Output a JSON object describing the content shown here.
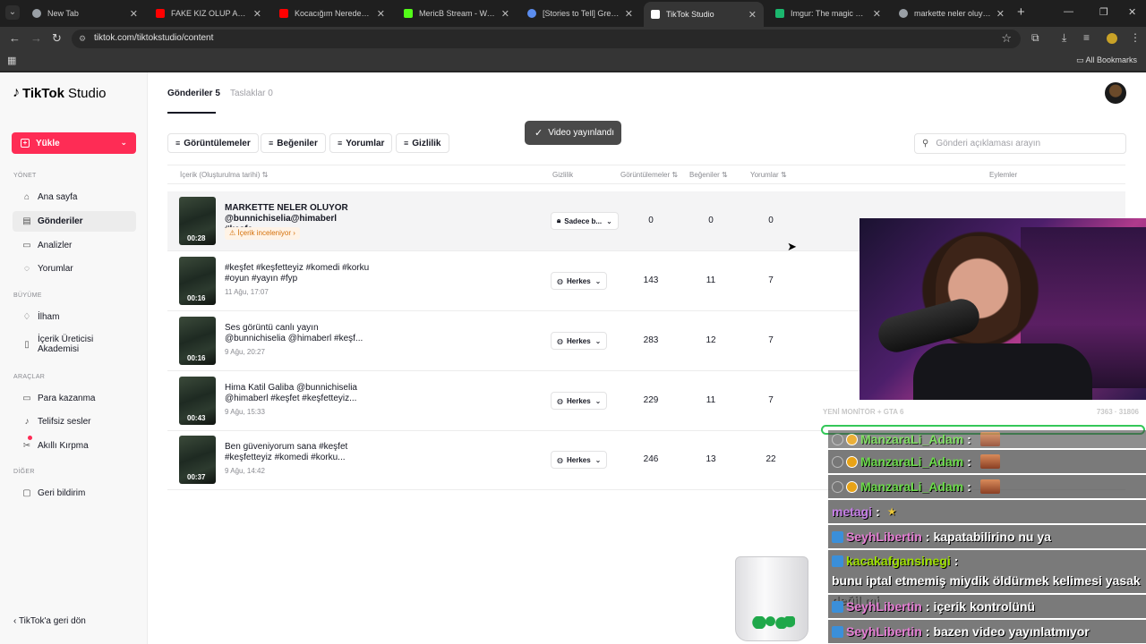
{
  "browser": {
    "tabs": [
      {
        "title": "New Tab",
        "fav": "#9aa0a6"
      },
      {
        "title": "FAKE KIZ OLUP AZGIN ÇO",
        "fav": "#ff0000"
      },
      {
        "title": "Kocacığım Neredesin Kon",
        "fav": "#ff0000"
      },
      {
        "title": "MericB Stream - Watch Li",
        "fav": "#53fc18"
      },
      {
        "title": "[Stories to Tell] Greyville S",
        "fav": "#5b8def"
      },
      {
        "title": "TikTok Studio",
        "fav": "#ffffff"
      },
      {
        "title": "Imgur: The magic of the I",
        "fav": "#1bb76e"
      },
      {
        "title": "markette neler oluyor.mp",
        "fav": "#9aa0a6"
      }
    ],
    "url": "tiktok.com/tiktokstudio/content",
    "bookmarks_label": "All Bookmarks"
  },
  "sidebar": {
    "logo_text": "TikTok",
    "logo_studio": "Studio",
    "upload_label": "Yükle",
    "sections": {
      "manage": "YÖNET",
      "growth": "BÜYÜME",
      "tools": "ARAÇLAR",
      "other": "DİĞER"
    },
    "items": {
      "home": "Ana sayfa",
      "posts": "Gönderiler",
      "analytics": "Analizler",
      "comments": "Yorumlar",
      "inspiration": "İlham",
      "academy": "İçerik Üreticisi Akademisi",
      "monetization": "Para kazanma",
      "sounds": "Telifsiz sesler",
      "smart_cut": "Akıllı Kırpma",
      "feedback": "Geri bildirim"
    },
    "back_link": "TikTok'a geri dön"
  },
  "main": {
    "tab_posts": "Gönderiler 5",
    "tab_drafts": "Taslaklar 0",
    "toast": "Video yayınlandı",
    "filters": [
      "Görüntülemeler",
      "Beğeniler",
      "Yorumlar",
      "Gizlilik"
    ],
    "search_placeholder": "Gönderi açıklaması arayın",
    "headers": {
      "content": "İçerik (Oluşturulma tarihi)",
      "privacy": "Gizlilik",
      "views": "Görüntülemeler",
      "likes": "Beğeniler",
      "comments": "Yorumlar",
      "actions": "Eylemler"
    },
    "rows": [
      {
        "caption": "MARKETTE NELER OLUYOR @bunnichiselia@himaberl #keşfe...",
        "duration": "00:28",
        "status": "İçerik inceleniyor",
        "date": "",
        "privacy": "Sadece b...",
        "views": "0",
        "likes": "0",
        "comments": "0"
      },
      {
        "caption": "#keşfet #keşfetteyiz #komedi #korku #oyun #yayın #fyp",
        "duration": "00:16",
        "status": "",
        "date": "11 Ağu, 17:07",
        "privacy": "Herkes",
        "views": "143",
        "likes": "11",
        "comments": "7"
      },
      {
        "caption": "Ses görüntü canlı yayın @bunnichiselia @himaberl #keşf...",
        "duration": "00:16",
        "status": "",
        "date": "9 Ağu, 20:27",
        "privacy": "Herkes",
        "views": "283",
        "likes": "12",
        "comments": "7"
      },
      {
        "caption": "Hima Katil Galiba @bunnichiselia @himaberl #keşfet #keşfetteyiz...",
        "duration": "00:43",
        "status": "",
        "date": "9 Ağu, 15:33",
        "privacy": "Herkes",
        "views": "229",
        "likes": "11",
        "comments": "7"
      },
      {
        "caption": "Ben güveniyorum sana #keşfet #keşfetteyiz #komedi #korku...",
        "duration": "00:37",
        "status": "",
        "date": "9 Ağu, 14:42",
        "privacy": "Herkes",
        "views": "246",
        "likes": "13",
        "comments": "22"
      }
    ]
  },
  "overlay": {
    "chat_header_left": "YENİ MONİTÖR + GTA 6",
    "chat_header_right": "7363 · 31806",
    "messages": [
      {
        "user": "ManzaraLi_Adam",
        "text": ""
      },
      {
        "user": "ManzaraLi_Adam",
        "text": ""
      },
      {
        "user": "ManzaraLi_Adam",
        "text": ""
      },
      {
        "user": "metagi",
        "text": ""
      },
      {
        "user": "SeyhLibertin",
        "text": "kapatabilirino nu ya"
      },
      {
        "user": "kacakafgansinegi",
        "text": "bunu iptal etmemiş miydik öldürmek kelimesi yasak değil mi"
      },
      {
        "user": "SeyhLibertin",
        "text": "içerik kontrolünü"
      },
      {
        "user": "SeyhLibertin",
        "text": "bazen video yayınlatmıyor"
      }
    ]
  }
}
